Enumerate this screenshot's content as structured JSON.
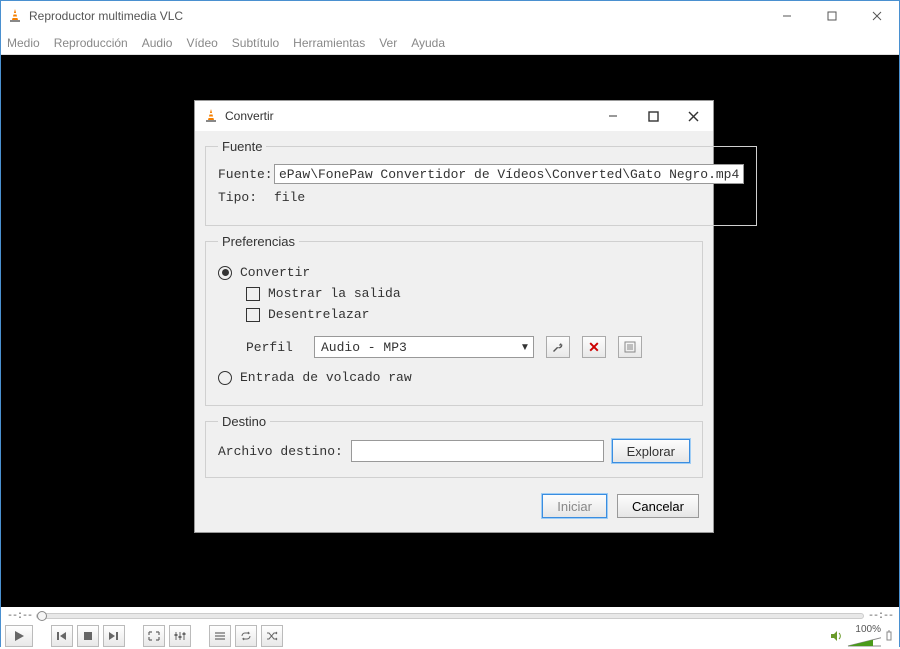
{
  "window": {
    "title": "Reproductor multimedia VLC"
  },
  "menubar": {
    "items": [
      "Medio",
      "Reproducción",
      "Audio",
      "Vídeo",
      "Subtítulo",
      "Herramientas",
      "Ver",
      "Ayuda"
    ]
  },
  "dialog": {
    "title": "Convertir",
    "fuente": {
      "legend": "Fuente",
      "label_fuente": "Fuente:",
      "value": "ePaw\\FonePaw Convertidor de Vídeos\\Converted\\Gato Negro.mp4",
      "label_tipo": "Tipo:",
      "tipo_value": "file"
    },
    "pref": {
      "legend": "Preferencias",
      "radio_convertir": "Convertir",
      "chk_mostrar": "Mostrar la salida",
      "chk_desentrelazar": "Desentrelazar",
      "label_perfil": "Perfil",
      "perfil_value": "Audio - MP3",
      "radio_raw": "Entrada de volcado raw"
    },
    "destino": {
      "legend": "Destino",
      "label_archivo": "Archivo destino:",
      "btn_explorar": "Explorar"
    },
    "btn_iniciar": "Iniciar",
    "btn_cancelar": "Cancelar"
  },
  "seek": {
    "left": "--:--",
    "right": "--:--"
  },
  "volume": {
    "pct": "100%"
  }
}
